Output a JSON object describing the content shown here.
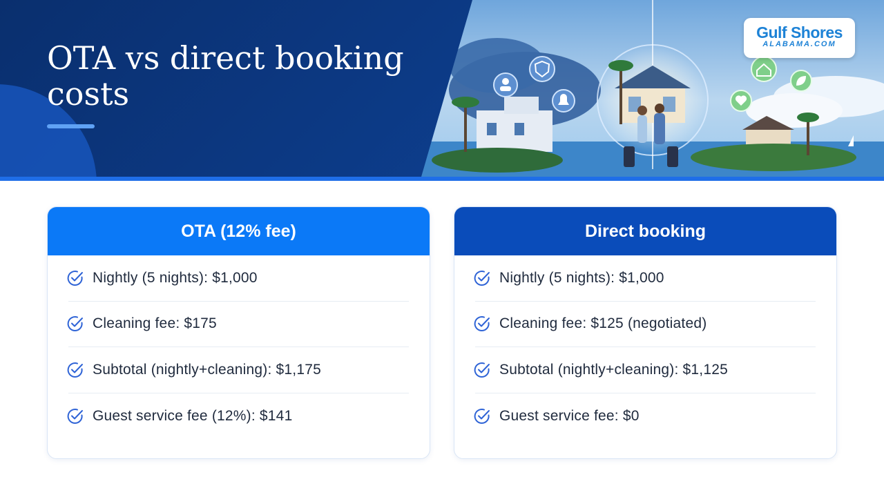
{
  "hero": {
    "title": "OTA vs direct booking costs",
    "logo_main": "Gulf Shores",
    "logo_sub": "ALABAMA.COM"
  },
  "cards": [
    {
      "title": "OTA (12% fee)",
      "header_color": "#0b79f7",
      "rows": [
        "Nightly (5 nights): $1,000",
        "Cleaning fee: $175",
        "Subtotal (nightly+cleaning): $1,175",
        "Guest service fee (12%): $141"
      ]
    },
    {
      "title": "Direct booking",
      "header_color": "#0a4cba",
      "rows": [
        "Nightly (5 nights): $1,000",
        "Cleaning fee: $125 (negotiated)",
        "Subtotal (nightly+cleaning): $1,125",
        "Guest service fee: $0"
      ]
    }
  ],
  "icons": {
    "row_icon": "check-circle-icon",
    "hero_icons": [
      "user-icon",
      "shield-icon",
      "bell-icon",
      "home-icon",
      "leaf-icon",
      "heart-icon"
    ]
  },
  "colors": {
    "check": "#2e63d6",
    "hero_dark": "#0c3a80",
    "accent": "#5fa2f5"
  }
}
